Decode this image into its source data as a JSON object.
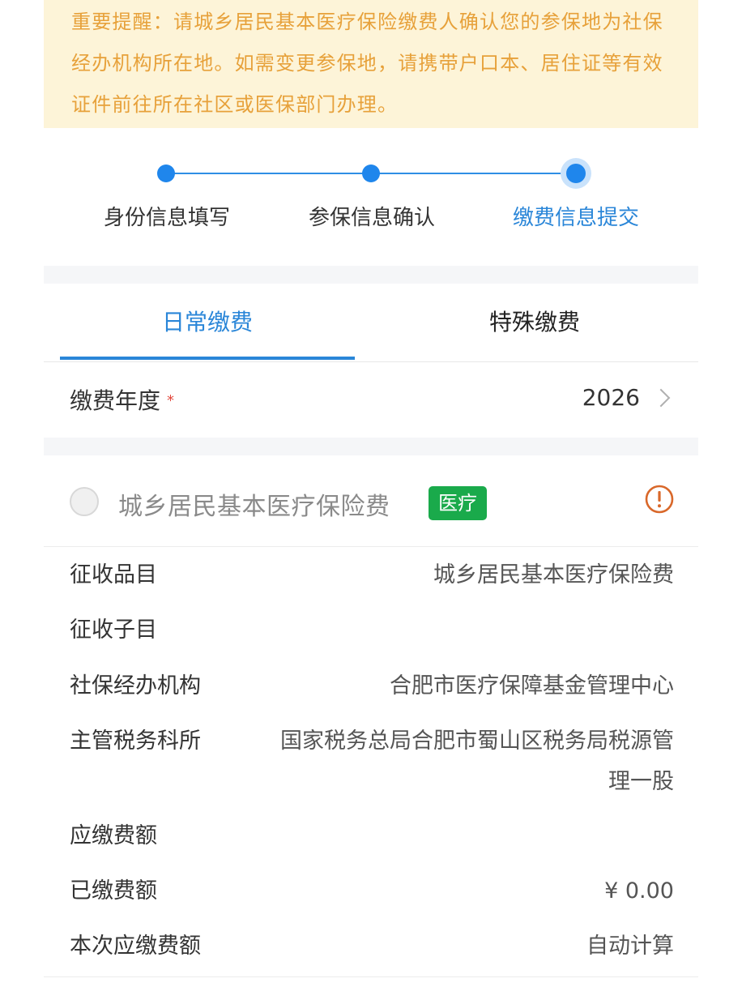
{
  "notice": {
    "text": "重要提醒：请城乡居民基本医疗保险缴费人确认您的参保地为社保经办机构所在地。如需变更参保地，请携带户口本、居住证等有效证件前往所在社区或医保部门办理。"
  },
  "steps": [
    {
      "label": "身份信息填写",
      "state": "done"
    },
    {
      "label": "参保信息确认",
      "state": "done"
    },
    {
      "label": "缴费信息提交",
      "state": "active"
    }
  ],
  "tabs": [
    {
      "label": "日常缴费",
      "active": true
    },
    {
      "label": "特殊缴费",
      "active": false
    }
  ],
  "year_field": {
    "label": "缴费年度",
    "required_mark": "*",
    "value": "2026"
  },
  "insurance_item": {
    "title": "城乡居民基本医疗保险费",
    "badge": "医疗",
    "badge_color": "#1aaa4b",
    "warning_icon": "exclamation-circle-icon",
    "warning_color": "#d9682a"
  },
  "details": [
    {
      "label": "征收品目",
      "value": "城乡居民基本医疗保险费"
    },
    {
      "label": "征收子目",
      "value": ""
    },
    {
      "label": "社保经办机构",
      "value": "合肥市医疗保障基金管理中心"
    },
    {
      "label": "主管税务科所",
      "value": "国家税务总局合肥市蜀山区税务局税源管理一股"
    },
    {
      "label": "应缴费额",
      "value": ""
    },
    {
      "label": "已缴费额",
      "value": "¥  0.00"
    },
    {
      "label": "本次应缴费额",
      "value": "自动计算"
    }
  ],
  "colors": {
    "accent": "#2a86d8",
    "notice_bg": "#fdf4d8",
    "notice_text": "#e7a13a"
  }
}
